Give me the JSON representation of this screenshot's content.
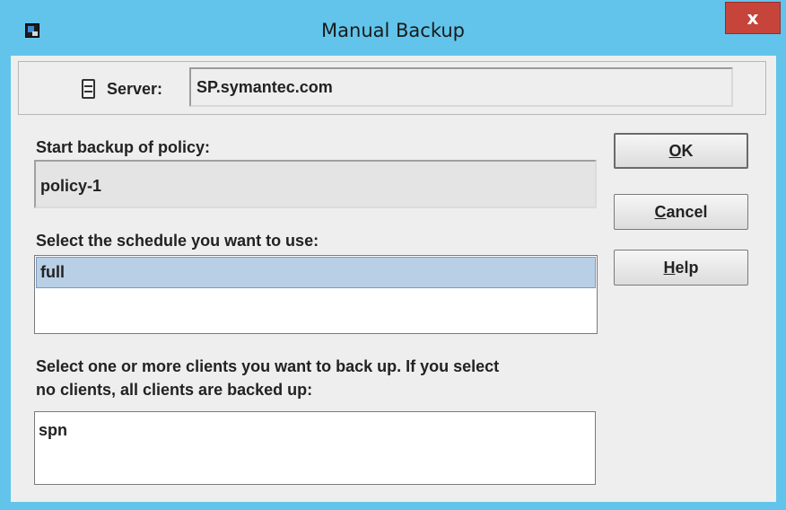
{
  "window": {
    "title": "Manual Backup",
    "close_label": "x"
  },
  "server": {
    "label": "Server:",
    "value": "SP.symantec.com"
  },
  "policy": {
    "label": "Start backup of policy:",
    "value": "policy-1"
  },
  "schedule": {
    "label": "Select the schedule you want to use:",
    "items": [
      "full"
    ],
    "selected": "full"
  },
  "clients": {
    "label_line1": "Select one or more clients you want to back up. If you select",
    "label_line2": "no clients, all clients are backed up:",
    "items": [
      "spn"
    ]
  },
  "buttons": {
    "ok": {
      "mnemonic": "O",
      "rest": "K"
    },
    "cancel": {
      "mnemonic": "C",
      "rest": "ancel"
    },
    "help": {
      "mnemonic": "H",
      "rest": "elp"
    }
  },
  "colors": {
    "titlebar": "#62c4ea",
    "close": "#c7443b",
    "selection": "#b8cfe5",
    "dialog_bg": "#eeeeee"
  }
}
